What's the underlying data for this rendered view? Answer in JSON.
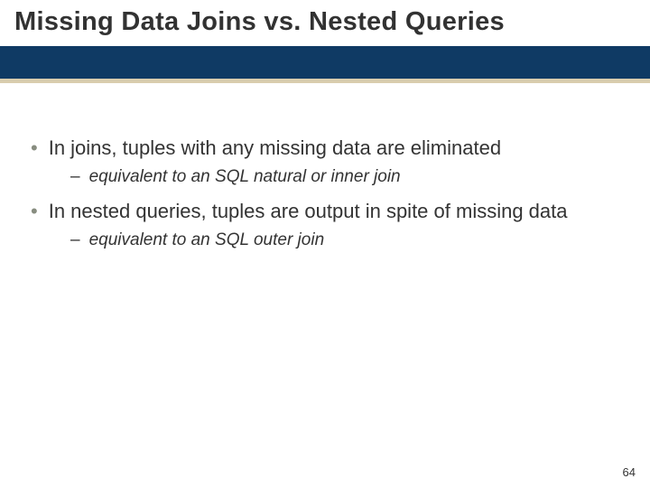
{
  "slide": {
    "title": "Missing Data Joins vs. Nested Queries",
    "bullets": [
      {
        "text": "In joins, tuples with any missing data are eliminated",
        "sub": "equivalent to an SQL natural or inner join"
      },
      {
        "text": "In nested queries, tuples are output in spite of missing data",
        "sub": "equivalent to an SQL outer join"
      }
    ],
    "page_number": "64"
  }
}
